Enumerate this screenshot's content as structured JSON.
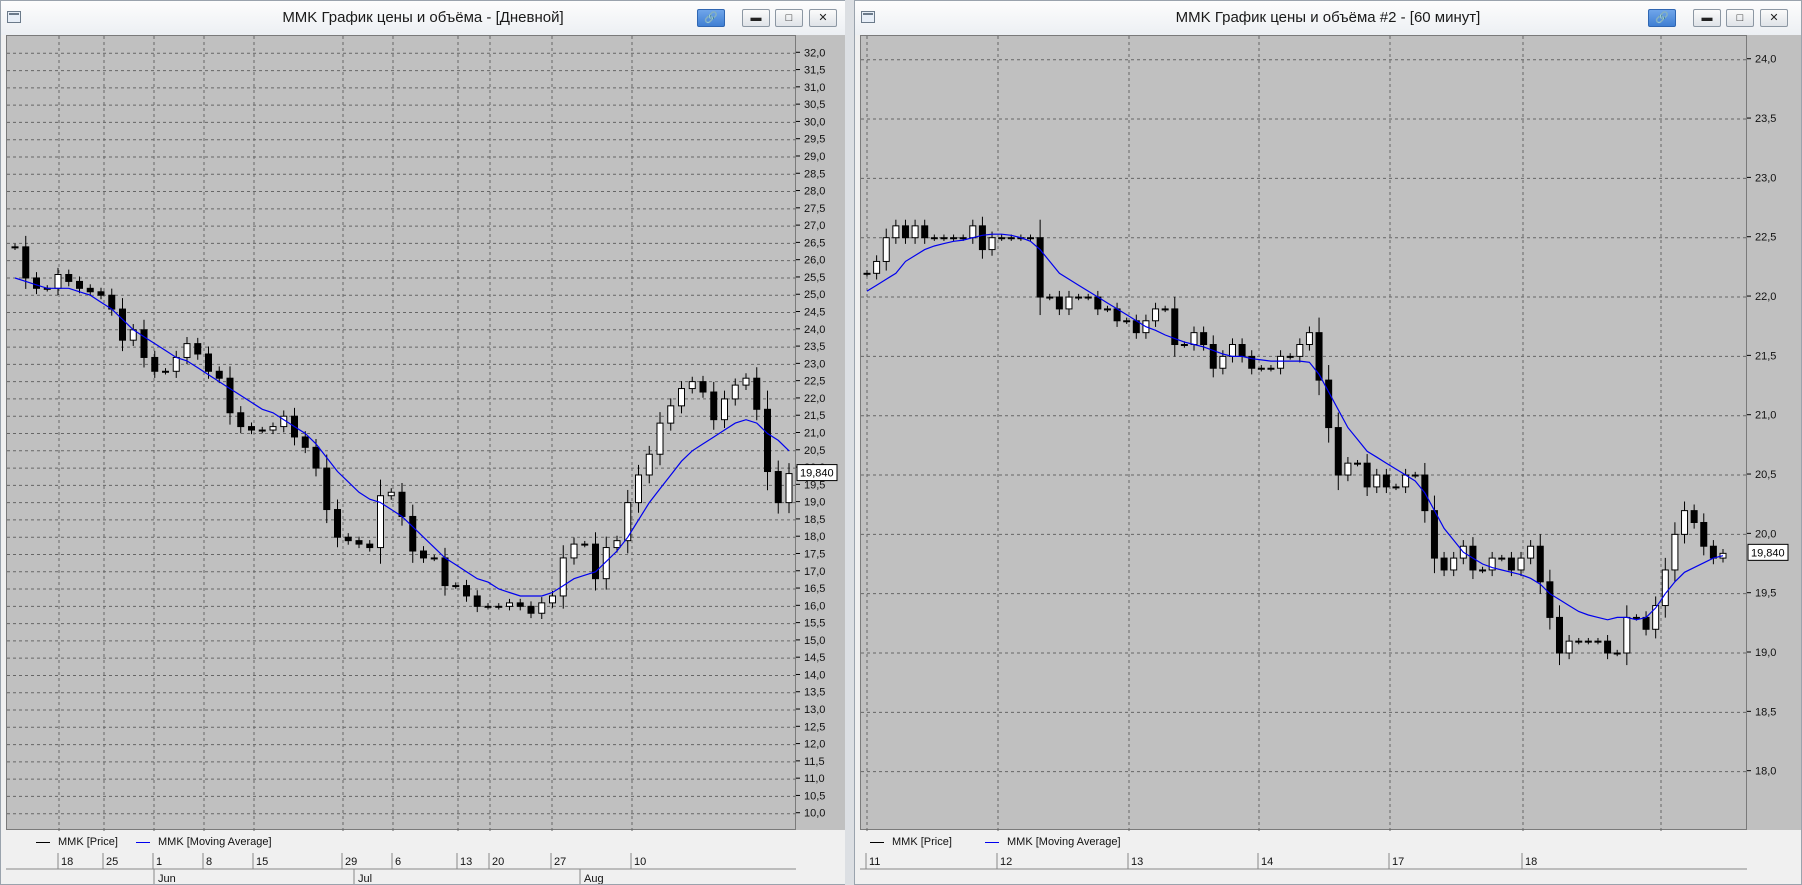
{
  "windows": [
    {
      "title": "MMK График цены и объёма - [Дневной]",
      "legend": [
        {
          "label": "MMK [Price]",
          "color": "#000000"
        },
        {
          "label": "MMK [Moving Average]",
          "color": "#0000ee"
        }
      ],
      "last_price_label": "19,840",
      "x_date_labels": [
        "18",
        "25",
        "1",
        "8",
        "15",
        "29",
        "6",
        "13",
        "20",
        "27",
        "10"
      ],
      "x_month_labels": [
        "Jun",
        "Jul",
        "Aug"
      ]
    },
    {
      "title": "MMK График цены и объёма #2 - [60 минут]",
      "legend": [
        {
          "label": "MMK [Price]",
          "color": "#000000"
        },
        {
          "label": "MMK [Moving Average]",
          "color": "#0000ee"
        }
      ],
      "last_price_label": "19,840",
      "x_date_labels": [
        "11",
        "12",
        "13",
        "14",
        "17",
        "18"
      ],
      "x_month_labels": []
    }
  ],
  "chart_data": [
    {
      "type": "candlestick",
      "ylim": [
        9.5,
        32.5
      ],
      "y_ticks": [
        "32,0",
        "31,5",
        "31,0",
        "30,5",
        "30,0",
        "29,5",
        "29,0",
        "28,5",
        "28,0",
        "27,5",
        "27,0",
        "26,5",
        "26,0",
        "25,5",
        "25,0",
        "24,5",
        "24,0",
        "23,5",
        "23,0",
        "22,5",
        "22,0",
        "21,5",
        "21,0",
        "20,5",
        "20,0",
        "19,5",
        "19,0",
        "18,5",
        "18,0",
        "17,5",
        "17,0",
        "16,5",
        "16,0",
        "15,5",
        "15,0",
        "14,5",
        "14,0",
        "13,5",
        "13,0",
        "12,5",
        "12,0",
        "11,5",
        "11,0",
        "10,5",
        "10,0"
      ],
      "close": [
        26.4,
        25.5,
        25.2,
        25.2,
        25.6,
        25.4,
        25.2,
        25.1,
        25.0,
        24.6,
        23.7,
        24.0,
        23.2,
        22.8,
        22.8,
        23.2,
        23.6,
        23.3,
        22.8,
        22.6,
        21.6,
        21.2,
        21.1,
        21.1,
        21.2,
        21.5,
        20.9,
        20.6,
        20.0,
        18.8,
        18.0,
        17.9,
        17.8,
        17.7,
        19.2,
        19.3,
        18.6,
        17.6,
        17.4,
        17.4,
        16.6,
        16.6,
        16.3,
        16.0,
        16.0,
        16.0,
        16.1,
        16.0,
        15.8,
        16.1,
        16.3,
        17.4,
        17.8,
        17.8,
        16.8,
        17.7,
        17.9,
        19.0,
        19.8,
        20.4,
        21.3,
        21.8,
        22.3,
        22.5,
        22.2,
        21.4,
        22.0,
        22.4,
        22.6,
        21.7,
        19.9,
        19.0,
        19.84
      ],
      "moving_average": [
        25.5,
        25.4,
        25.3,
        25.2,
        25.2,
        25.2,
        25.1,
        25.0,
        24.8,
        24.6,
        24.3,
        24.0,
        23.8,
        23.6,
        23.4,
        23.2,
        23.1,
        22.9,
        22.7,
        22.5,
        22.3,
        22.1,
        21.9,
        21.7,
        21.6,
        21.4,
        21.2,
        21.0,
        20.7,
        20.3,
        19.9,
        19.6,
        19.3,
        19.1,
        19.0,
        18.8,
        18.6,
        18.3,
        18.0,
        17.7,
        17.4,
        17.2,
        17.0,
        16.8,
        16.7,
        16.5,
        16.4,
        16.3,
        16.3,
        16.3,
        16.4,
        16.6,
        16.8,
        16.9,
        17.0,
        17.3,
        17.6,
        18.0,
        18.5,
        19.0,
        19.4,
        19.8,
        20.2,
        20.5,
        20.7,
        20.9,
        21.1,
        21.3,
        21.4,
        21.3,
        21.0,
        20.8,
        20.5
      ]
    },
    {
      "type": "candlestick",
      "ylim": [
        17.5,
        24.2
      ],
      "y_ticks": [
        "24,0",
        "23,5",
        "23,0",
        "22,5",
        "22,0",
        "21,5",
        "21,0",
        "20,5",
        "20,0",
        "19,5",
        "19,0",
        "18,5",
        "18,0"
      ],
      "close": [
        22.2,
        22.3,
        22.5,
        22.6,
        22.5,
        22.6,
        22.5,
        22.5,
        22.5,
        22.5,
        22.5,
        22.6,
        22.4,
        22.5,
        22.5,
        22.5,
        22.5,
        22.5,
        22.0,
        22.0,
        21.9,
        22.0,
        22.0,
        22.0,
        21.9,
        21.9,
        21.8,
        21.8,
        21.7,
        21.8,
        21.9,
        21.9,
        21.6,
        21.6,
        21.7,
        21.6,
        21.4,
        21.5,
        21.6,
        21.5,
        21.4,
        21.4,
        21.4,
        21.5,
        21.5,
        21.6,
        21.7,
        21.3,
        20.9,
        20.5,
        20.6,
        20.6,
        20.4,
        20.5,
        20.4,
        20.4,
        20.5,
        20.5,
        20.2,
        19.8,
        19.7,
        19.8,
        19.9,
        19.7,
        19.7,
        19.8,
        19.8,
        19.7,
        19.8,
        19.9,
        19.6,
        19.3,
        19.0,
        19.1,
        19.1,
        19.1,
        19.1,
        19.0,
        19.0,
        19.3,
        19.3,
        19.2,
        19.4,
        19.7,
        20.0,
        20.2,
        20.1,
        19.9,
        19.8,
        19.84
      ],
      "moving_average": [
        22.05,
        22.1,
        22.15,
        22.2,
        22.3,
        22.35,
        22.4,
        22.43,
        22.45,
        22.47,
        22.48,
        22.5,
        22.52,
        22.53,
        22.53,
        22.52,
        22.5,
        22.47,
        22.4,
        22.3,
        22.2,
        22.15,
        22.1,
        22.05,
        22.0,
        21.95,
        21.9,
        21.85,
        21.8,
        21.75,
        21.72,
        21.68,
        21.65,
        21.62,
        21.6,
        21.58,
        21.55,
        21.52,
        21.5,
        21.5,
        21.48,
        21.47,
        21.46,
        21.46,
        21.46,
        21.46,
        21.45,
        21.35,
        21.2,
        21.05,
        20.9,
        20.8,
        20.7,
        20.65,
        20.6,
        20.55,
        20.5,
        20.45,
        20.35,
        20.2,
        20.05,
        19.95,
        19.85,
        19.8,
        19.75,
        19.72,
        19.7,
        19.68,
        19.66,
        19.63,
        19.58,
        19.5,
        19.45,
        19.4,
        19.35,
        19.32,
        19.3,
        19.28,
        19.3,
        19.3,
        19.28,
        19.3,
        19.38,
        19.5,
        19.6,
        19.68,
        19.72,
        19.76,
        19.8,
        19.82
      ]
    }
  ]
}
